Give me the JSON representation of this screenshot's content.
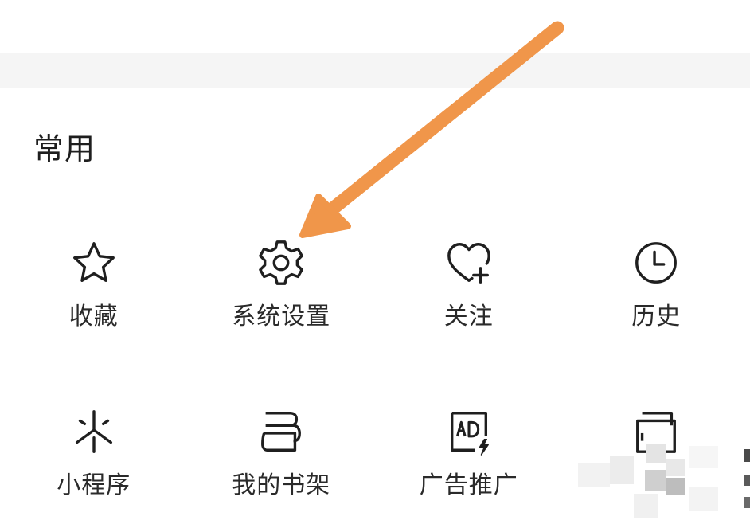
{
  "section": {
    "title": "常用"
  },
  "items": [
    {
      "label": "收藏",
      "icon": "star-icon"
    },
    {
      "label": "系统设置",
      "icon": "gear-icon"
    },
    {
      "label": "关注",
      "icon": "heart-plus-icon"
    },
    {
      "label": "历史",
      "icon": "clock-icon"
    },
    {
      "label": "小程序",
      "icon": "mini-program-icon"
    },
    {
      "label": "我的书架",
      "icon": "bookshelf-icon"
    },
    {
      "label": "广告推广",
      "icon": "ad-icon"
    },
    {
      "label": "",
      "icon": "wallet-icon"
    }
  ],
  "colors": {
    "arrow": "#F0964A",
    "icon_stroke": "#1f1f1f",
    "band": "#f5f5f5"
  }
}
